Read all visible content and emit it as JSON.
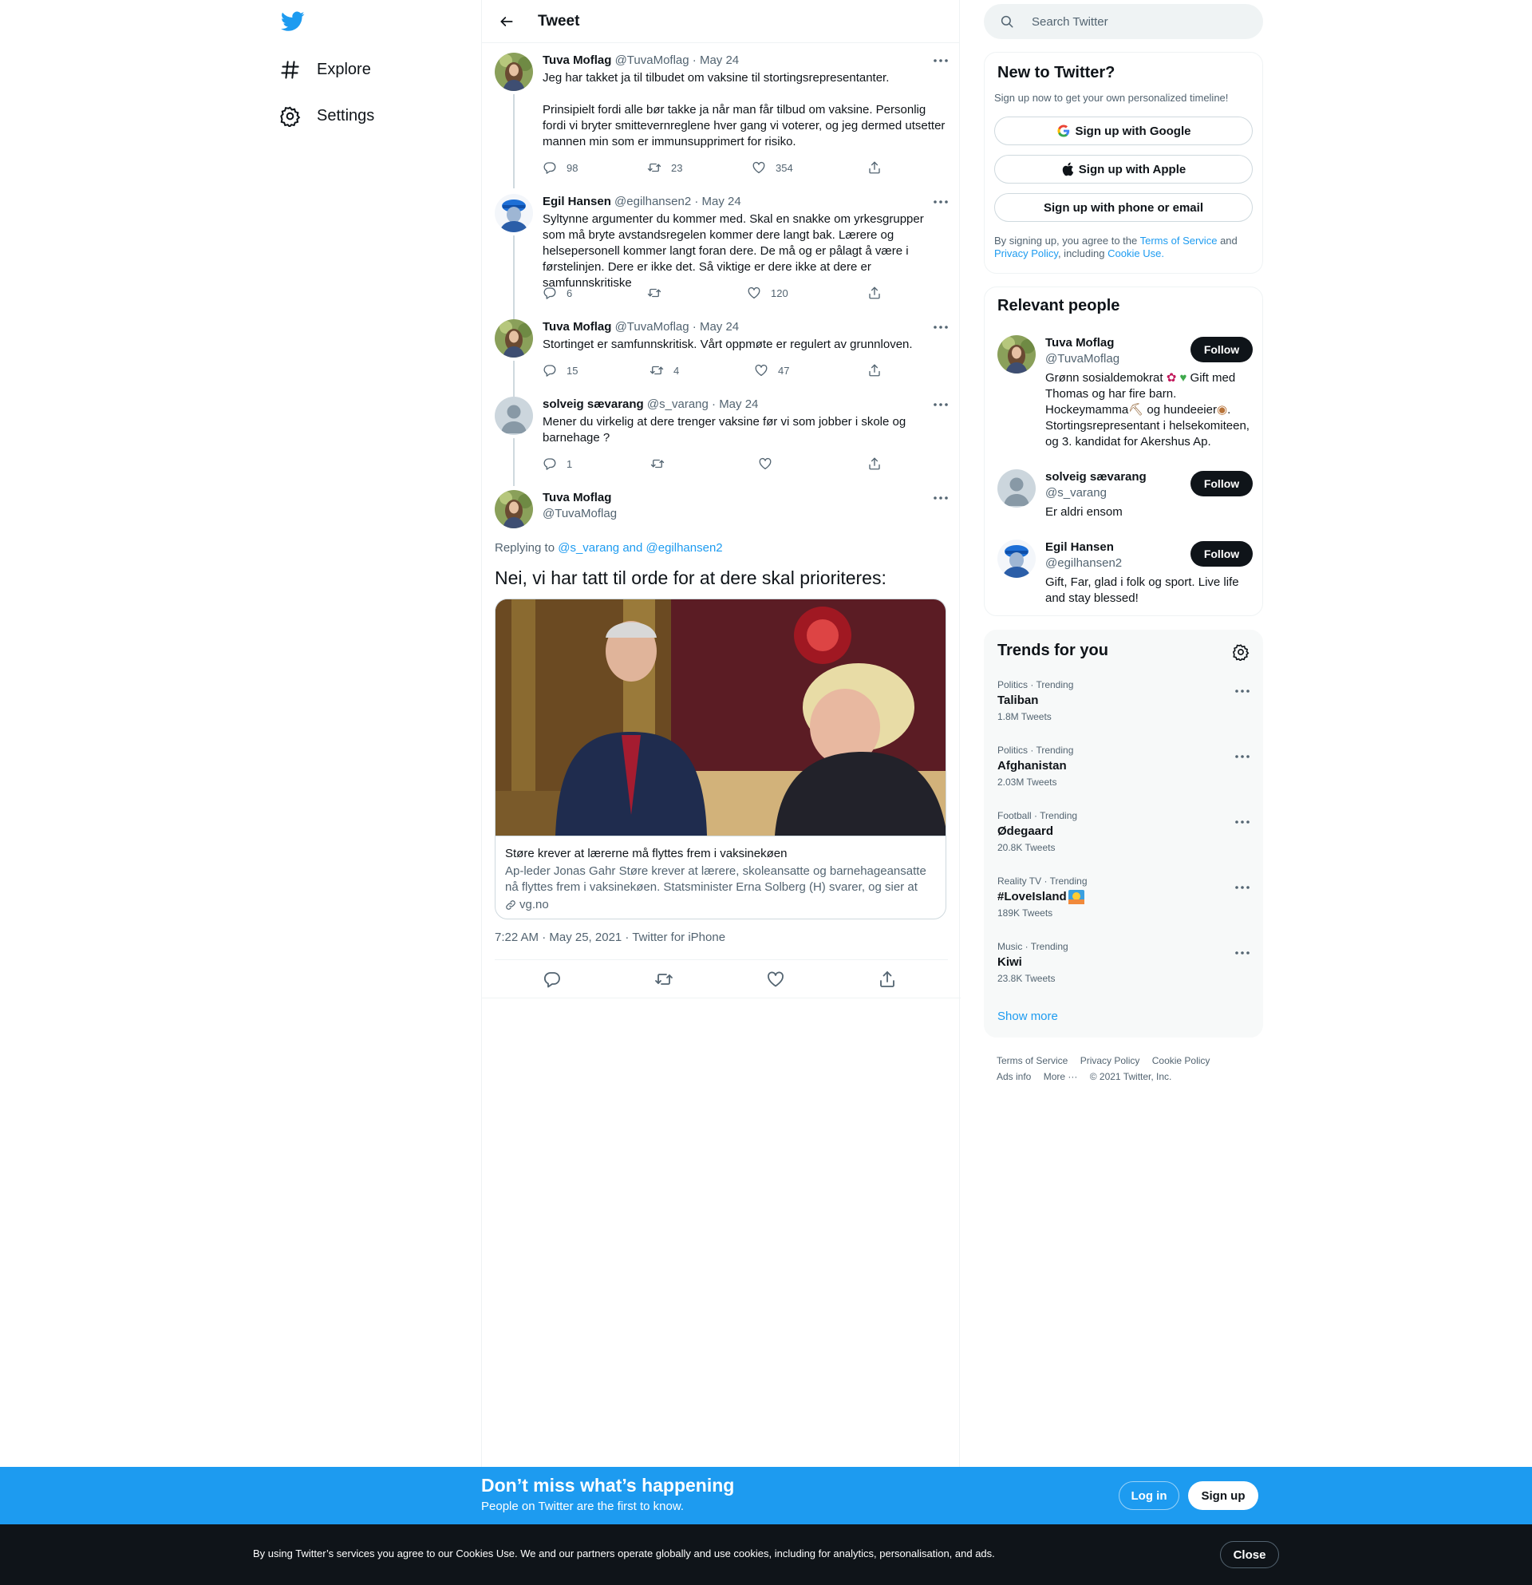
{
  "nav": {
    "logo_icon": "twitter-bird-icon",
    "items": [
      {
        "label": "Explore",
        "icon": "hashtag-icon"
      },
      {
        "label": "Settings",
        "icon": "gear-icon"
      }
    ]
  },
  "header": {
    "title": "Tweet",
    "back_icon": "back-arrow-icon"
  },
  "thread": [
    {
      "name": "Tuva Moflag",
      "handle": "@TuvaMoflag",
      "date": "May 24",
      "text": "Jeg har takket ja til tilbudet om vaksine til stortingsrepresentanter.\n\nPrinsipielt fordi alle bør takke ja når man får tilbud om vaksine. Personlig fordi vi bryter smittevernreglene hver gang vi voterer, og jeg dermed utsetter mannen min som er immunsupprimert for risiko.",
      "replies": "98",
      "retweets": "23",
      "likes": "354"
    },
    {
      "name": "Egil Hansen",
      "handle": "@egilhansen2",
      "date": "May 24",
      "text": "Syltynne argumenter du kommer med. Skal en snakke om yrkesgrupper som må bryte avstandsregelen kommer dere langt bak. Lærere og helsepersonell kommer langt foran dere. De må og er pålagt å være i førstelinjen. Dere er ikke det. Så viktige er dere ikke at dere er samfunnskritiske",
      "replies": "6",
      "retweets": "",
      "likes": "120"
    },
    {
      "name": "Tuva Moflag",
      "handle": "@TuvaMoflag",
      "date": "May 24",
      "text": "Stortinget er samfunnskritisk. Vårt oppmøte er regulert av grunnloven.",
      "replies": "15",
      "retweets": "4",
      "likes": "47"
    },
    {
      "name": "solveig sævarang",
      "handle": "@s_varang",
      "date": "May 24",
      "text": "Mener du virkelig at dere trenger vaksine før vi som jobber i skole og barnehage ?",
      "replies": "1",
      "retweets": "",
      "likes": ""
    }
  ],
  "dot_separator": "·",
  "focal": {
    "name": "Tuva Moflag",
    "handle": "@TuvaMoflag",
    "replying_prefix": "Replying to",
    "replying_to": "@s_varang and @egilhansen2",
    "text": "Nei, vi har tatt til orde for at dere skal prioriteres:",
    "card": {
      "title": "Støre krever at lærerne må flyttes frem i vaksinekøen",
      "description": "Ap-leder Jonas Gahr Støre krever at lærere, skoleansatte og barnehageansatte nå flyttes frem i vaksinekøen. Statsminister Erna Solberg (H) svarer, og sier at andr...",
      "domain": "vg.no"
    },
    "timestamp": "7:22 AM · May 25, 2021 · Twitter for iPhone"
  },
  "search": {
    "placeholder": "Search Twitter"
  },
  "new_to_twitter": {
    "title": "New to Twitter?",
    "subtitle": "Sign up now to get your own personalized timeline!",
    "google": "Sign up with Google",
    "apple": "Sign up with Apple",
    "phone": "Sign up with phone or email",
    "legal_prefix": "By signing up, you agree to the",
    "terms": "Terms of Service",
    "and": "and",
    "privacy": "Privacy Policy",
    "including": ", including",
    "cookie": "Cookie Use."
  },
  "relevant_people": {
    "title": "Relevant people",
    "follow_label": "Follow",
    "people": [
      {
        "name": "Tuva Moflag",
        "handle": "@TuvaMoflag",
        "bio_1": "Grønn sosialdemokrat ",
        "bio_2": " Gift med Thomas og har fire barn. Hockeymamma",
        "bio_3": " og hundeeier",
        "bio_4": ". Stortingsrepresentant i helsekomiteen, og 3. kandidat for Akershus Ap."
      },
      {
        "name": "solveig sævarang",
        "handle": "@s_varang",
        "bio_1": "Er aldri ensom"
      },
      {
        "name": "Egil Hansen",
        "handle": "@egilhansen2",
        "bio_1": "Gift, Far, glad i folk og sport. Live life and stay blessed!"
      }
    ]
  },
  "trends": {
    "title": "Trends for you",
    "items": [
      {
        "category": "Politics · Trending",
        "name": "Taliban",
        "count": "1.8M Tweets"
      },
      {
        "category": "Politics · Trending",
        "name": "Afghanistan",
        "count": "2.03M Tweets"
      },
      {
        "category": "Football · Trending",
        "name": "Ødegaard",
        "count": "20.8K Tweets"
      },
      {
        "category": "Reality TV · Trending",
        "name": "#LoveIsland",
        "count": "189K Tweets"
      },
      {
        "category": "Music · Trending",
        "name": "Kiwi",
        "count": "23.8K Tweets"
      }
    ],
    "show_more": "Show more"
  },
  "footer": {
    "terms": "Terms of Service",
    "privacy": "Privacy Policy",
    "cookie": "Cookie Policy",
    "ads": "Ads info",
    "more": "More ···",
    "copyright": "© 2021 Twitter, Inc."
  },
  "promo": {
    "title": "Don’t miss what’s happening",
    "subtitle": "People on Twitter are the first to know.",
    "login": "Log in",
    "signup": "Sign up"
  },
  "cookie_bar": {
    "text": "By using Twitter’s services you agree to our Cookies Use. We and our partners operate globally and use cookies, including for analytics, personalisation, and ads.",
    "close": "Close"
  },
  "colors": {
    "accent": "#1d9bf0",
    "text": "#0f1419",
    "secondary": "#536471",
    "border": "#eff3f4"
  }
}
